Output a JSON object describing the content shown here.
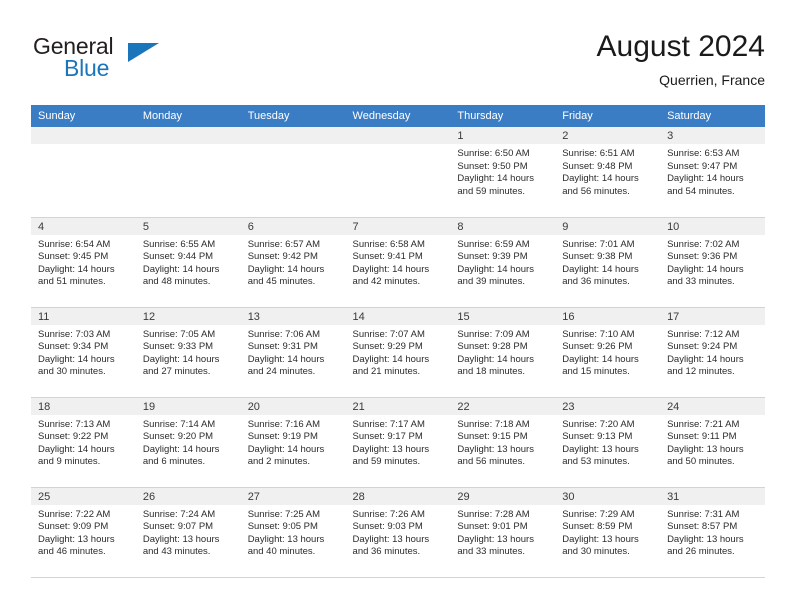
{
  "brand": {
    "word1": "General",
    "word2": "Blue",
    "triangle_color": "#1b75bb",
    "text_color": "#231f20"
  },
  "header": {
    "title": "August 2024",
    "subtitle": "Querrien, France"
  },
  "theme": {
    "header_row_bg": "#3b7dc4",
    "header_row_text": "#ffffff",
    "daynum_band_bg": "#f0f0f0",
    "grid_line": "#d4d4d4"
  },
  "calendar": {
    "weekday_headers": [
      "Sunday",
      "Monday",
      "Tuesday",
      "Wednesday",
      "Thursday",
      "Friday",
      "Saturday"
    ],
    "labels": {
      "sunrise": "Sunrise:",
      "sunset": "Sunset:",
      "daylight": "Daylight:"
    },
    "weeks": [
      [
        {
          "day": "",
          "sunrise": "",
          "sunset": "",
          "daylight_l1": "",
          "daylight_l2": "",
          "empty": true
        },
        {
          "day": "",
          "sunrise": "",
          "sunset": "",
          "daylight_l1": "",
          "daylight_l2": "",
          "empty": true
        },
        {
          "day": "",
          "sunrise": "",
          "sunset": "",
          "daylight_l1": "",
          "daylight_l2": "",
          "empty": true
        },
        {
          "day": "",
          "sunrise": "",
          "sunset": "",
          "daylight_l1": "",
          "daylight_l2": "",
          "empty": true
        },
        {
          "day": "1",
          "sunrise": "Sunrise: 6:50 AM",
          "sunset": "Sunset: 9:50 PM",
          "daylight_l1": "Daylight: 14 hours",
          "daylight_l2": "and 59 minutes."
        },
        {
          "day": "2",
          "sunrise": "Sunrise: 6:51 AM",
          "sunset": "Sunset: 9:48 PM",
          "daylight_l1": "Daylight: 14 hours",
          "daylight_l2": "and 56 minutes."
        },
        {
          "day": "3",
          "sunrise": "Sunrise: 6:53 AM",
          "sunset": "Sunset: 9:47 PM",
          "daylight_l1": "Daylight: 14 hours",
          "daylight_l2": "and 54 minutes."
        }
      ],
      [
        {
          "day": "4",
          "sunrise": "Sunrise: 6:54 AM",
          "sunset": "Sunset: 9:45 PM",
          "daylight_l1": "Daylight: 14 hours",
          "daylight_l2": "and 51 minutes."
        },
        {
          "day": "5",
          "sunrise": "Sunrise: 6:55 AM",
          "sunset": "Sunset: 9:44 PM",
          "daylight_l1": "Daylight: 14 hours",
          "daylight_l2": "and 48 minutes."
        },
        {
          "day": "6",
          "sunrise": "Sunrise: 6:57 AM",
          "sunset": "Sunset: 9:42 PM",
          "daylight_l1": "Daylight: 14 hours",
          "daylight_l2": "and 45 minutes."
        },
        {
          "day": "7",
          "sunrise": "Sunrise: 6:58 AM",
          "sunset": "Sunset: 9:41 PM",
          "daylight_l1": "Daylight: 14 hours",
          "daylight_l2": "and 42 minutes."
        },
        {
          "day": "8",
          "sunrise": "Sunrise: 6:59 AM",
          "sunset": "Sunset: 9:39 PM",
          "daylight_l1": "Daylight: 14 hours",
          "daylight_l2": "and 39 minutes."
        },
        {
          "day": "9",
          "sunrise": "Sunrise: 7:01 AM",
          "sunset": "Sunset: 9:38 PM",
          "daylight_l1": "Daylight: 14 hours",
          "daylight_l2": "and 36 minutes."
        },
        {
          "day": "10",
          "sunrise": "Sunrise: 7:02 AM",
          "sunset": "Sunset: 9:36 PM",
          "daylight_l1": "Daylight: 14 hours",
          "daylight_l2": "and 33 minutes."
        }
      ],
      [
        {
          "day": "11",
          "sunrise": "Sunrise: 7:03 AM",
          "sunset": "Sunset: 9:34 PM",
          "daylight_l1": "Daylight: 14 hours",
          "daylight_l2": "and 30 minutes."
        },
        {
          "day": "12",
          "sunrise": "Sunrise: 7:05 AM",
          "sunset": "Sunset: 9:33 PM",
          "daylight_l1": "Daylight: 14 hours",
          "daylight_l2": "and 27 minutes."
        },
        {
          "day": "13",
          "sunrise": "Sunrise: 7:06 AM",
          "sunset": "Sunset: 9:31 PM",
          "daylight_l1": "Daylight: 14 hours",
          "daylight_l2": "and 24 minutes."
        },
        {
          "day": "14",
          "sunrise": "Sunrise: 7:07 AM",
          "sunset": "Sunset: 9:29 PM",
          "daylight_l1": "Daylight: 14 hours",
          "daylight_l2": "and 21 minutes."
        },
        {
          "day": "15",
          "sunrise": "Sunrise: 7:09 AM",
          "sunset": "Sunset: 9:28 PM",
          "daylight_l1": "Daylight: 14 hours",
          "daylight_l2": "and 18 minutes."
        },
        {
          "day": "16",
          "sunrise": "Sunrise: 7:10 AM",
          "sunset": "Sunset: 9:26 PM",
          "daylight_l1": "Daylight: 14 hours",
          "daylight_l2": "and 15 minutes."
        },
        {
          "day": "17",
          "sunrise": "Sunrise: 7:12 AM",
          "sunset": "Sunset: 9:24 PM",
          "daylight_l1": "Daylight: 14 hours",
          "daylight_l2": "and 12 minutes."
        }
      ],
      [
        {
          "day": "18",
          "sunrise": "Sunrise: 7:13 AM",
          "sunset": "Sunset: 9:22 PM",
          "daylight_l1": "Daylight: 14 hours",
          "daylight_l2": "and 9 minutes."
        },
        {
          "day": "19",
          "sunrise": "Sunrise: 7:14 AM",
          "sunset": "Sunset: 9:20 PM",
          "daylight_l1": "Daylight: 14 hours",
          "daylight_l2": "and 6 minutes."
        },
        {
          "day": "20",
          "sunrise": "Sunrise: 7:16 AM",
          "sunset": "Sunset: 9:19 PM",
          "daylight_l1": "Daylight: 14 hours",
          "daylight_l2": "and 2 minutes."
        },
        {
          "day": "21",
          "sunrise": "Sunrise: 7:17 AM",
          "sunset": "Sunset: 9:17 PM",
          "daylight_l1": "Daylight: 13 hours",
          "daylight_l2": "and 59 minutes."
        },
        {
          "day": "22",
          "sunrise": "Sunrise: 7:18 AM",
          "sunset": "Sunset: 9:15 PM",
          "daylight_l1": "Daylight: 13 hours",
          "daylight_l2": "and 56 minutes."
        },
        {
          "day": "23",
          "sunrise": "Sunrise: 7:20 AM",
          "sunset": "Sunset: 9:13 PM",
          "daylight_l1": "Daylight: 13 hours",
          "daylight_l2": "and 53 minutes."
        },
        {
          "day": "24",
          "sunrise": "Sunrise: 7:21 AM",
          "sunset": "Sunset: 9:11 PM",
          "daylight_l1": "Daylight: 13 hours",
          "daylight_l2": "and 50 minutes."
        }
      ],
      [
        {
          "day": "25",
          "sunrise": "Sunrise: 7:22 AM",
          "sunset": "Sunset: 9:09 PM",
          "daylight_l1": "Daylight: 13 hours",
          "daylight_l2": "and 46 minutes."
        },
        {
          "day": "26",
          "sunrise": "Sunrise: 7:24 AM",
          "sunset": "Sunset: 9:07 PM",
          "daylight_l1": "Daylight: 13 hours",
          "daylight_l2": "and 43 minutes."
        },
        {
          "day": "27",
          "sunrise": "Sunrise: 7:25 AM",
          "sunset": "Sunset: 9:05 PM",
          "daylight_l1": "Daylight: 13 hours",
          "daylight_l2": "and 40 minutes."
        },
        {
          "day": "28",
          "sunrise": "Sunrise: 7:26 AM",
          "sunset": "Sunset: 9:03 PM",
          "daylight_l1": "Daylight: 13 hours",
          "daylight_l2": "and 36 minutes."
        },
        {
          "day": "29",
          "sunrise": "Sunrise: 7:28 AM",
          "sunset": "Sunset: 9:01 PM",
          "daylight_l1": "Daylight: 13 hours",
          "daylight_l2": "and 33 minutes."
        },
        {
          "day": "30",
          "sunrise": "Sunrise: 7:29 AM",
          "sunset": "Sunset: 8:59 PM",
          "daylight_l1": "Daylight: 13 hours",
          "daylight_l2": "and 30 minutes."
        },
        {
          "day": "31",
          "sunrise": "Sunrise: 7:31 AM",
          "sunset": "Sunset: 8:57 PM",
          "daylight_l1": "Daylight: 13 hours",
          "daylight_l2": "and 26 minutes."
        }
      ]
    ]
  }
}
